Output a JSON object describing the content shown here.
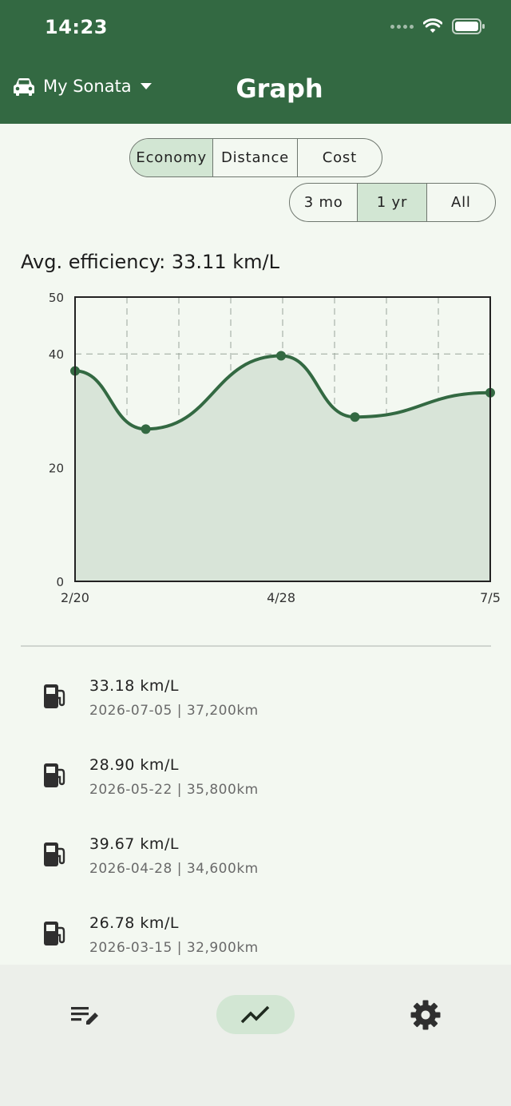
{
  "status": {
    "time": "14:23"
  },
  "header": {
    "car_name": "My Sonata",
    "title": "Graph"
  },
  "metric_tabs": [
    {
      "label": "Economy",
      "active": true
    },
    {
      "label": "Distance",
      "active": false
    },
    {
      "label": "Cost",
      "active": false
    }
  ],
  "range_tabs": [
    {
      "label": "3 mo",
      "active": false
    },
    {
      "label": "1 yr",
      "active": true
    },
    {
      "label": "All",
      "active": false
    }
  ],
  "summary": {
    "avg_text": "Avg. efficiency: 33.11 km/L"
  },
  "chart_data": {
    "type": "area",
    "x_tick_labels": [
      "2/20",
      "4/28",
      "7/5"
    ],
    "y_tick_labels": [
      "0",
      "20",
      "40",
      "50"
    ],
    "ylim": [
      0,
      50
    ],
    "grid": true,
    "points": [
      {
        "date": "2026-02-20",
        "value": 37.0
      },
      {
        "date": "2026-03-15",
        "value": 26.78
      },
      {
        "date": "2026-04-28",
        "value": 39.67
      },
      {
        "date": "2026-05-22",
        "value": 28.9
      },
      {
        "date": "2026-07-05",
        "value": 33.18
      }
    ],
    "colors": {
      "line": "#336942",
      "fill": "#d8e4d8"
    }
  },
  "entries": [
    {
      "value": "33.18 km/L",
      "detail": "2026-07-05 | 37,200km"
    },
    {
      "value": "28.90 km/L",
      "detail": "2026-05-22 | 35,800km"
    },
    {
      "value": "39.67 km/L",
      "detail": "2026-04-28 | 34,600km"
    },
    {
      "value": "26.78 km/L",
      "detail": "2026-03-15 | 32,900km"
    }
  ],
  "nav": [
    {
      "icon": "edit-list-icon"
    },
    {
      "icon": "trend-line-icon",
      "active": true
    },
    {
      "icon": "gear-icon"
    }
  ],
  "colors": {
    "primary": "#336942",
    "accent_bg": "#d2e6d3",
    "background": "#f3f8f1"
  }
}
